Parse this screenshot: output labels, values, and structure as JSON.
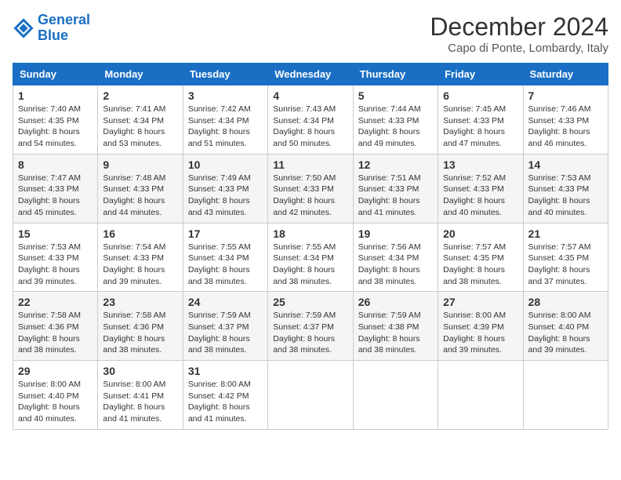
{
  "logo": {
    "line1": "General",
    "line2": "Blue"
  },
  "title": "December 2024",
  "subtitle": "Capo di Ponte, Lombardy, Italy",
  "weekdays": [
    "Sunday",
    "Monday",
    "Tuesday",
    "Wednesday",
    "Thursday",
    "Friday",
    "Saturday"
  ],
  "weeks": [
    [
      {
        "day": "1",
        "sunrise": "Sunrise: 7:40 AM",
        "sunset": "Sunset: 4:35 PM",
        "daylight": "Daylight: 8 hours and 54 minutes."
      },
      {
        "day": "2",
        "sunrise": "Sunrise: 7:41 AM",
        "sunset": "Sunset: 4:34 PM",
        "daylight": "Daylight: 8 hours and 53 minutes."
      },
      {
        "day": "3",
        "sunrise": "Sunrise: 7:42 AM",
        "sunset": "Sunset: 4:34 PM",
        "daylight": "Daylight: 8 hours and 51 minutes."
      },
      {
        "day": "4",
        "sunrise": "Sunrise: 7:43 AM",
        "sunset": "Sunset: 4:34 PM",
        "daylight": "Daylight: 8 hours and 50 minutes."
      },
      {
        "day": "5",
        "sunrise": "Sunrise: 7:44 AM",
        "sunset": "Sunset: 4:33 PM",
        "daylight": "Daylight: 8 hours and 49 minutes."
      },
      {
        "day": "6",
        "sunrise": "Sunrise: 7:45 AM",
        "sunset": "Sunset: 4:33 PM",
        "daylight": "Daylight: 8 hours and 47 minutes."
      },
      {
        "day": "7",
        "sunrise": "Sunrise: 7:46 AM",
        "sunset": "Sunset: 4:33 PM",
        "daylight": "Daylight: 8 hours and 46 minutes."
      }
    ],
    [
      {
        "day": "8",
        "sunrise": "Sunrise: 7:47 AM",
        "sunset": "Sunset: 4:33 PM",
        "daylight": "Daylight: 8 hours and 45 minutes."
      },
      {
        "day": "9",
        "sunrise": "Sunrise: 7:48 AM",
        "sunset": "Sunset: 4:33 PM",
        "daylight": "Daylight: 8 hours and 44 minutes."
      },
      {
        "day": "10",
        "sunrise": "Sunrise: 7:49 AM",
        "sunset": "Sunset: 4:33 PM",
        "daylight": "Daylight: 8 hours and 43 minutes."
      },
      {
        "day": "11",
        "sunrise": "Sunrise: 7:50 AM",
        "sunset": "Sunset: 4:33 PM",
        "daylight": "Daylight: 8 hours and 42 minutes."
      },
      {
        "day": "12",
        "sunrise": "Sunrise: 7:51 AM",
        "sunset": "Sunset: 4:33 PM",
        "daylight": "Daylight: 8 hours and 41 minutes."
      },
      {
        "day": "13",
        "sunrise": "Sunrise: 7:52 AM",
        "sunset": "Sunset: 4:33 PM",
        "daylight": "Daylight: 8 hours and 40 minutes."
      },
      {
        "day": "14",
        "sunrise": "Sunrise: 7:53 AM",
        "sunset": "Sunset: 4:33 PM",
        "daylight": "Daylight: 8 hours and 40 minutes."
      }
    ],
    [
      {
        "day": "15",
        "sunrise": "Sunrise: 7:53 AM",
        "sunset": "Sunset: 4:33 PM",
        "daylight": "Daylight: 8 hours and 39 minutes."
      },
      {
        "day": "16",
        "sunrise": "Sunrise: 7:54 AM",
        "sunset": "Sunset: 4:33 PM",
        "daylight": "Daylight: 8 hours and 39 minutes."
      },
      {
        "day": "17",
        "sunrise": "Sunrise: 7:55 AM",
        "sunset": "Sunset: 4:34 PM",
        "daylight": "Daylight: 8 hours and 38 minutes."
      },
      {
        "day": "18",
        "sunrise": "Sunrise: 7:55 AM",
        "sunset": "Sunset: 4:34 PM",
        "daylight": "Daylight: 8 hours and 38 minutes."
      },
      {
        "day": "19",
        "sunrise": "Sunrise: 7:56 AM",
        "sunset": "Sunset: 4:34 PM",
        "daylight": "Daylight: 8 hours and 38 minutes."
      },
      {
        "day": "20",
        "sunrise": "Sunrise: 7:57 AM",
        "sunset": "Sunset: 4:35 PM",
        "daylight": "Daylight: 8 hours and 38 minutes."
      },
      {
        "day": "21",
        "sunrise": "Sunrise: 7:57 AM",
        "sunset": "Sunset: 4:35 PM",
        "daylight": "Daylight: 8 hours and 37 minutes."
      }
    ],
    [
      {
        "day": "22",
        "sunrise": "Sunrise: 7:58 AM",
        "sunset": "Sunset: 4:36 PM",
        "daylight": "Daylight: 8 hours and 38 minutes."
      },
      {
        "day": "23",
        "sunrise": "Sunrise: 7:58 AM",
        "sunset": "Sunset: 4:36 PM",
        "daylight": "Daylight: 8 hours and 38 minutes."
      },
      {
        "day": "24",
        "sunrise": "Sunrise: 7:59 AM",
        "sunset": "Sunset: 4:37 PM",
        "daylight": "Daylight: 8 hours and 38 minutes."
      },
      {
        "day": "25",
        "sunrise": "Sunrise: 7:59 AM",
        "sunset": "Sunset: 4:37 PM",
        "daylight": "Daylight: 8 hours and 38 minutes."
      },
      {
        "day": "26",
        "sunrise": "Sunrise: 7:59 AM",
        "sunset": "Sunset: 4:38 PM",
        "daylight": "Daylight: 8 hours and 38 minutes."
      },
      {
        "day": "27",
        "sunrise": "Sunrise: 8:00 AM",
        "sunset": "Sunset: 4:39 PM",
        "daylight": "Daylight: 8 hours and 39 minutes."
      },
      {
        "day": "28",
        "sunrise": "Sunrise: 8:00 AM",
        "sunset": "Sunset: 4:40 PM",
        "daylight": "Daylight: 8 hours and 39 minutes."
      }
    ],
    [
      {
        "day": "29",
        "sunrise": "Sunrise: 8:00 AM",
        "sunset": "Sunset: 4:40 PM",
        "daylight": "Daylight: 8 hours and 40 minutes."
      },
      {
        "day": "30",
        "sunrise": "Sunrise: 8:00 AM",
        "sunset": "Sunset: 4:41 PM",
        "daylight": "Daylight: 8 hours and 41 minutes."
      },
      {
        "day": "31",
        "sunrise": "Sunrise: 8:00 AM",
        "sunset": "Sunset: 4:42 PM",
        "daylight": "Daylight: 8 hours and 41 minutes."
      },
      null,
      null,
      null,
      null
    ]
  ]
}
